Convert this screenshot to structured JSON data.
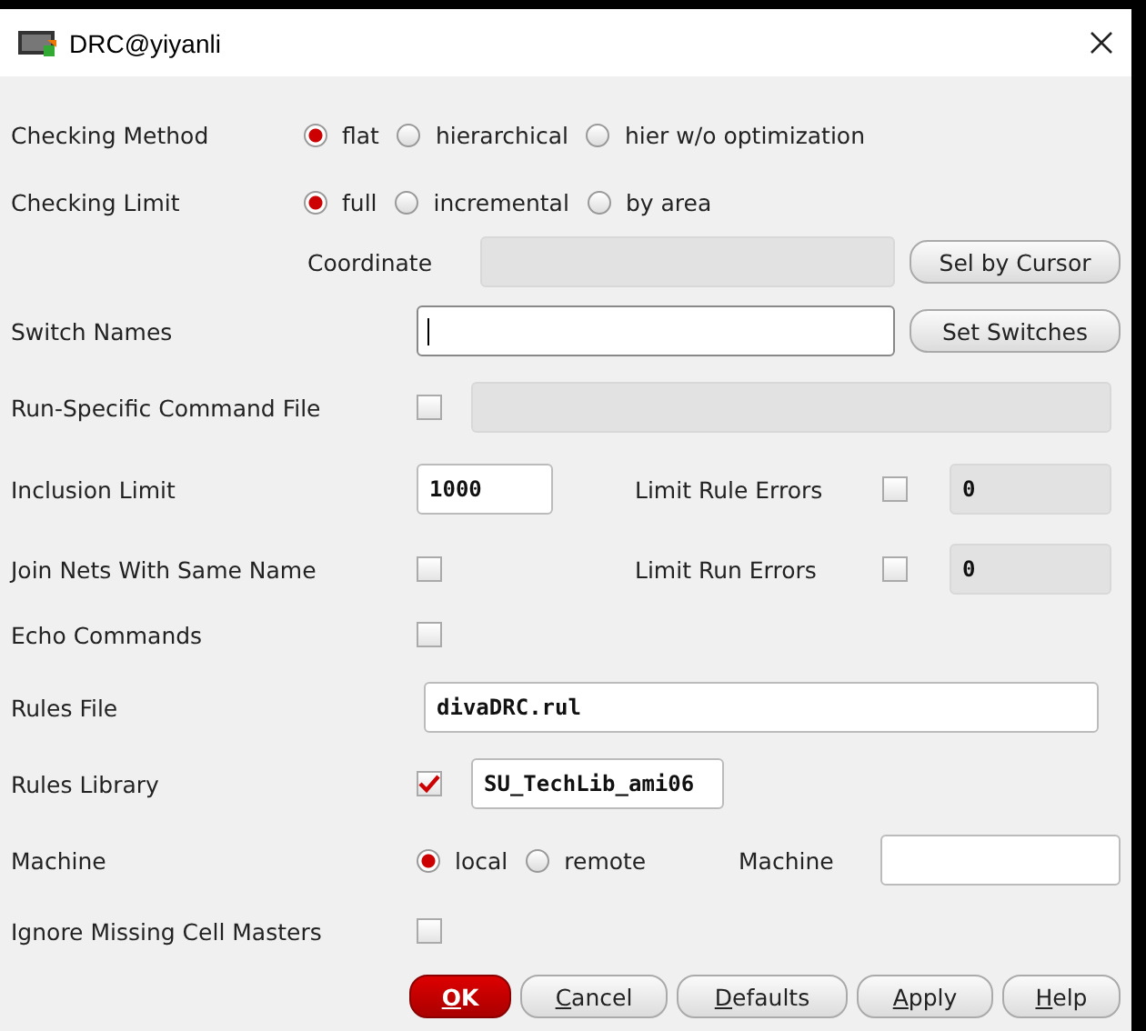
{
  "window": {
    "title": "DRC@yiyanli"
  },
  "checking_method": {
    "label": "Checking Method",
    "options": [
      {
        "label": "flat",
        "selected": true
      },
      {
        "label": "hierarchical",
        "selected": false
      },
      {
        "label": "hier w/o optimization",
        "selected": false
      }
    ]
  },
  "checking_limit": {
    "label": "Checking Limit",
    "options": [
      {
        "label": "full",
        "selected": true
      },
      {
        "label": "incremental",
        "selected": false
      },
      {
        "label": "by area",
        "selected": false
      }
    ]
  },
  "coordinate": {
    "label": "Coordinate",
    "disabled": true,
    "button": "Sel by Cursor"
  },
  "switch_names": {
    "label": "Switch Names",
    "button": "Set Switches"
  },
  "run_specific_command_file": {
    "label": "Run-Specific Command File",
    "checked": false,
    "disabled": true
  },
  "inclusion_limit": {
    "label": "Inclusion Limit",
    "value": "1000"
  },
  "limit_rule_errors": {
    "label": "Limit Rule Errors",
    "checked": false,
    "disabled": true,
    "value": "0"
  },
  "join_nets": {
    "label": "Join Nets With Same Name",
    "checked": false
  },
  "limit_run_errors": {
    "label": "Limit Run Errors",
    "checked": false,
    "disabled": true,
    "value": "0"
  },
  "echo_commands": {
    "label": "Echo Commands",
    "checked": false
  },
  "rules_file": {
    "label": "Rules File",
    "value": "divaDRC.rul"
  },
  "rules_library": {
    "label": "Rules Library",
    "checked": true,
    "value": "SU_TechLib_ami06"
  },
  "machine": {
    "label": "Machine",
    "options": [
      {
        "label": "local",
        "selected": true
      },
      {
        "label": "remote",
        "selected": false
      }
    ],
    "field_label": "Machine"
  },
  "ignore_missing": {
    "label": "Ignore Missing Cell Masters",
    "checked": false
  },
  "buttons": [
    {
      "mnemonic": "O",
      "rest": "K",
      "kind": "primary"
    },
    {
      "mnemonic": "C",
      "rest": "ancel",
      "kind": "normal"
    },
    {
      "mnemonic": "D",
      "rest": "efaults",
      "kind": "normal"
    },
    {
      "mnemonic": "A",
      "rest": "pply",
      "kind": "normal"
    },
    {
      "mnemonic": "H",
      "rest": "elp",
      "kind": "normal"
    }
  ]
}
